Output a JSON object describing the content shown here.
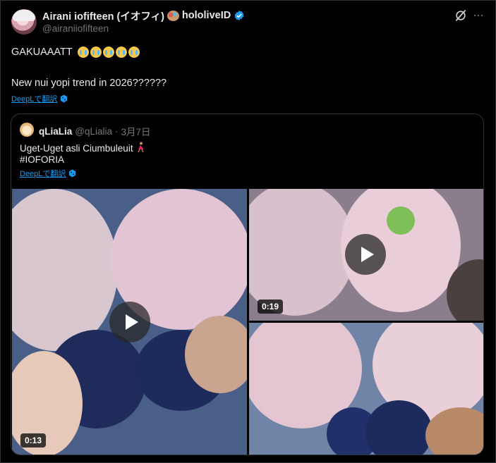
{
  "tweet": {
    "display_name": "Airani iofifteen (イオフィ)",
    "name_suffix": "hololiveID",
    "handle": "@airaniiofifteen",
    "line1": "GAKUAAATT",
    "line2": "New nui yopi trend in 2026??????",
    "translate_label": "DeepLで翻訳",
    "icons": [
      "avatar",
      "art-palette-emoji",
      "verified-badge-icon",
      "grok-icon",
      "more-icon",
      "loudly-crying-face-emoji",
      "deepl-icon"
    ]
  },
  "quote": {
    "name": "qLiaLia",
    "handle": "@qLialia",
    "separator": "·",
    "date": "3月7日",
    "line1": "Uget-Uget asli Ciumbuleuit",
    "line2": "#IOFORIA",
    "translate_label": "DeepLで翻訳",
    "media": [
      {
        "type": "video",
        "duration": "0:13"
      },
      {
        "type": "video",
        "duration": "0:19"
      },
      {
        "type": "video",
        "duration": ""
      }
    ]
  },
  "colors": {
    "background": "#000000",
    "text": "#e7e9ea",
    "muted": "#71767b",
    "accent": "#1d9bf0",
    "border": "#2f3336"
  }
}
